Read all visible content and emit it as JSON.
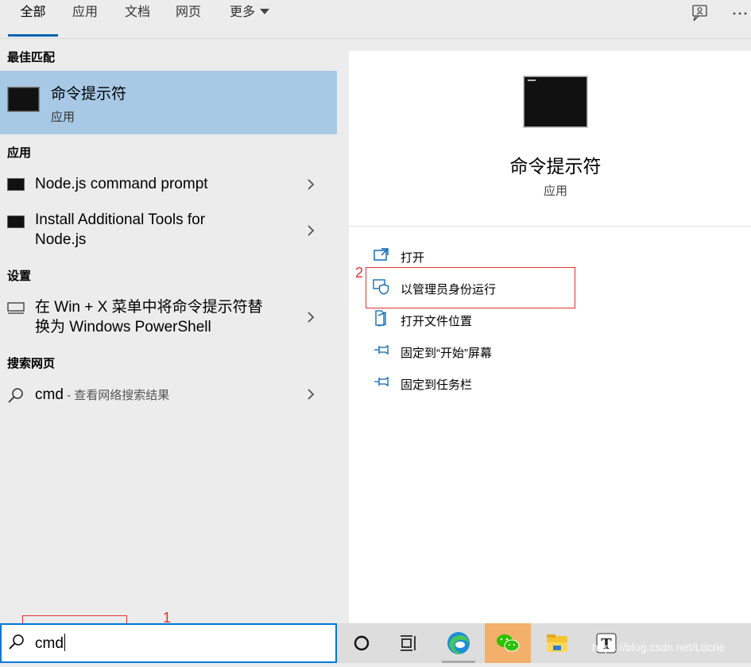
{
  "tabs": [
    {
      "label": "全部"
    },
    {
      "label": "应用"
    },
    {
      "label": "文档"
    },
    {
      "label": "网页"
    },
    {
      "label": "更多"
    }
  ],
  "left": {
    "best_match_title": "最佳匹配",
    "best_match": {
      "name": "命令提示符",
      "type": "应用"
    },
    "apps_title": "应用",
    "apps": [
      {
        "label": "Node.js command prompt"
      },
      {
        "label_line1": "Install Additional Tools for",
        "label_line2": "Node.js"
      }
    ],
    "settings_title": "设置",
    "setting": {
      "label_line1": "在 Win + X 菜单中将命令提示符替",
      "label_line2": "换为 Windows PowerShell"
    },
    "web_title": "搜索网页",
    "web": {
      "query": "cmd",
      "suffix": " - 查看网络搜索结果"
    }
  },
  "right": {
    "title": "命令提示符",
    "subtitle": "应用",
    "actions": [
      {
        "label": "打开",
        "icon": "open-icon"
      },
      {
        "label": "以管理员身份运行",
        "icon": "shield-icon"
      },
      {
        "label": "打开文件位置",
        "icon": "file-location-icon"
      },
      {
        "label": "固定到“开始”屏幕",
        "icon": "pin-icon"
      },
      {
        "label": "固定到任务栏",
        "icon": "pin-icon"
      }
    ]
  },
  "search": {
    "value": "cmd"
  },
  "annotations": {
    "one": "1",
    "two": "2"
  },
  "watermark": "https://blog.csdn.net/Ldcrle",
  "colors": {
    "accent": "#0078d7",
    "selected": "#a7c9e6",
    "annotation": "#e3342f"
  }
}
